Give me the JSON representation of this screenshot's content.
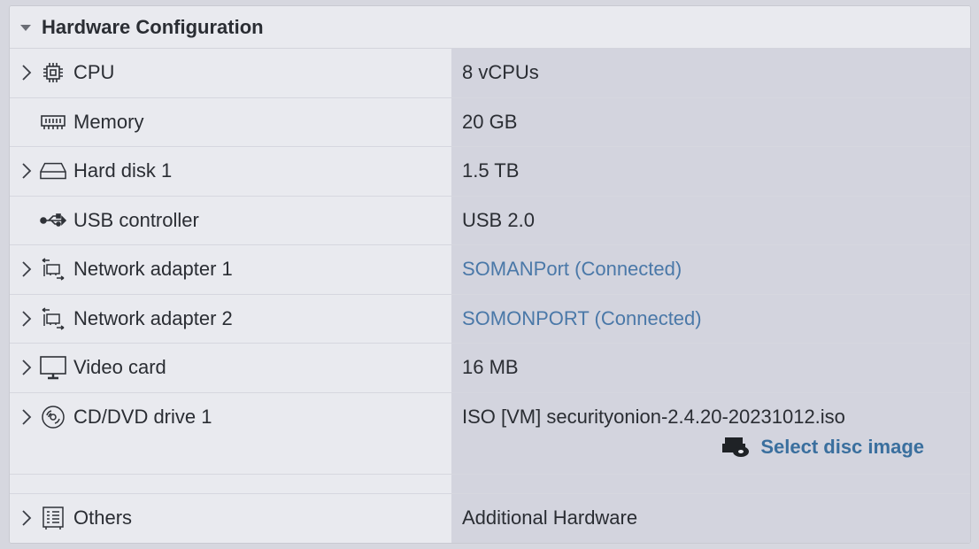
{
  "header": {
    "title": "Hardware Configuration"
  },
  "rows": [
    {
      "label": "CPU",
      "value": "8 vCPUs",
      "icon": "cpu-icon",
      "expandable": true
    },
    {
      "label": "Memory",
      "value": "20 GB",
      "icon": "memory-icon",
      "expandable": false
    },
    {
      "label": "Hard disk 1",
      "value": "1.5 TB",
      "icon": "hard-disk-icon",
      "expandable": true
    },
    {
      "label": "USB controller",
      "value": "USB 2.0",
      "icon": "usb-icon",
      "expandable": false
    },
    {
      "label": "Network adapter 1",
      "value": "SOMANPort (Connected)",
      "icon": "network-adapter-icon",
      "expandable": true
    },
    {
      "label": "Network adapter 2",
      "value": "SOMONPORT (Connected)",
      "icon": "network-adapter-icon",
      "expandable": true
    },
    {
      "label": "Video card",
      "value": "16 MB",
      "icon": "monitor-icon",
      "expandable": true
    },
    {
      "label": "CD/DVD drive 1",
      "value": "ISO [VM] securityonion-2.4.20-20231012.iso",
      "icon": "disc-icon",
      "expandable": true,
      "action": "Select disc image"
    },
    {
      "label": "Others",
      "value": "Additional Hardware",
      "icon": "others-icon",
      "expandable": true
    }
  ],
  "colors": {
    "link": "#4a78a8",
    "action": "#3a6f9e"
  }
}
